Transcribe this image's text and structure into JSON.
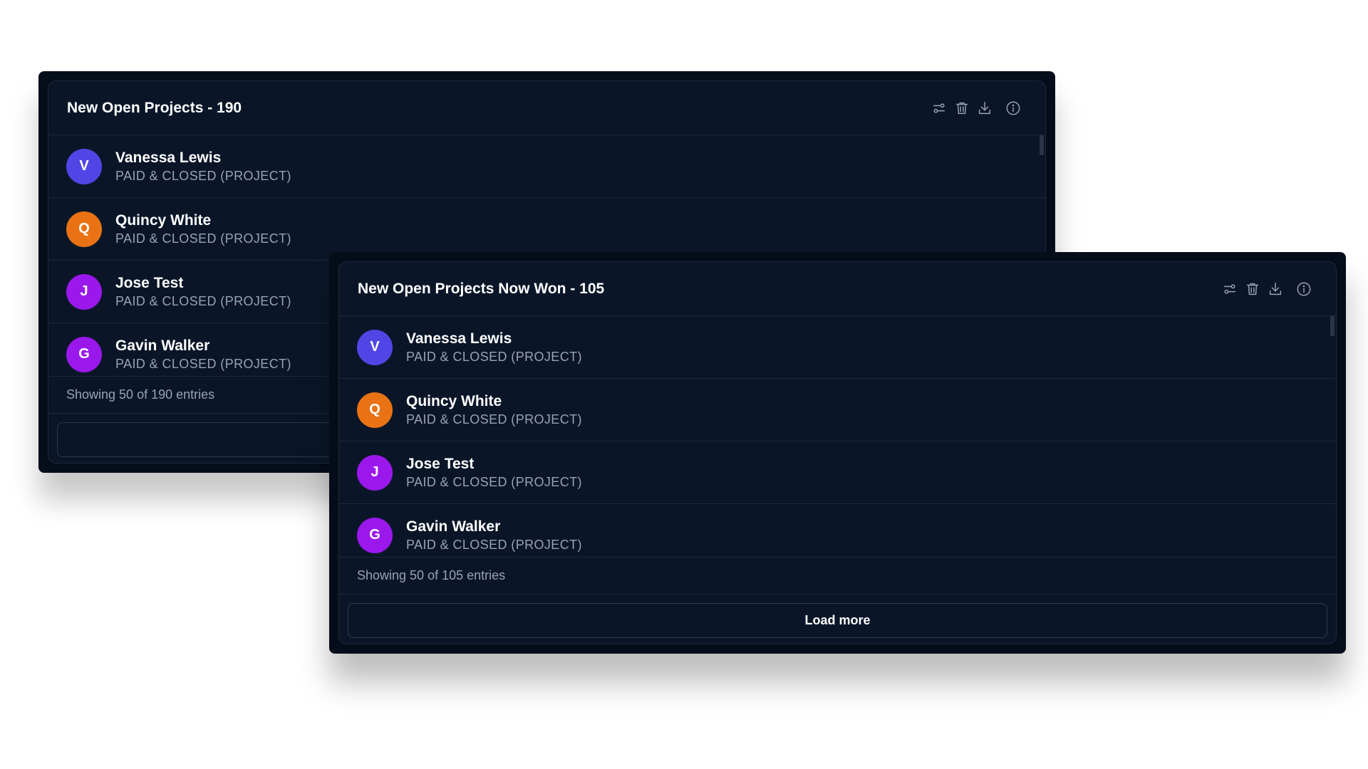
{
  "colors": {
    "avatar_v": "#4f46e5",
    "avatar_q": "#e97314",
    "avatar_j": "#9a18ec",
    "avatar_g": "#9a18ec",
    "panel_bg": "#0a1628",
    "outer_bg": "#050d1a"
  },
  "icons": [
    "filter-icon",
    "trash-icon",
    "download-icon",
    "info-icon"
  ],
  "back_panel": {
    "title": "New Open Projects - 190",
    "items": [
      {
        "initial": "V",
        "name": "Vanessa Lewis",
        "status": "PAID & CLOSED (PROJECT)"
      },
      {
        "initial": "Q",
        "name": "Quincy White",
        "status": "PAID & CLOSED (PROJECT)"
      },
      {
        "initial": "J",
        "name": "Jose Test",
        "status": "PAID & CLOSED (PROJECT)"
      },
      {
        "initial": "G",
        "name": "Gavin Walker",
        "status": "PAID & CLOSED (PROJECT)"
      }
    ],
    "footer": "Showing 50 of 190 entries",
    "load_more": ""
  },
  "front_panel": {
    "title": "New Open Projects Now Won - 105",
    "items": [
      {
        "initial": "V",
        "name": "Vanessa Lewis",
        "status": "PAID & CLOSED (PROJECT)"
      },
      {
        "initial": "Q",
        "name": "Quincy White",
        "status": "PAID & CLOSED (PROJECT)"
      },
      {
        "initial": "J",
        "name": "Jose Test",
        "status": "PAID & CLOSED (PROJECT)"
      },
      {
        "initial": "G",
        "name": "Gavin Walker",
        "status": "PAID & CLOSED (PROJECT)"
      }
    ],
    "footer": "Showing 50 of 105 entries",
    "load_more": "Load more"
  }
}
